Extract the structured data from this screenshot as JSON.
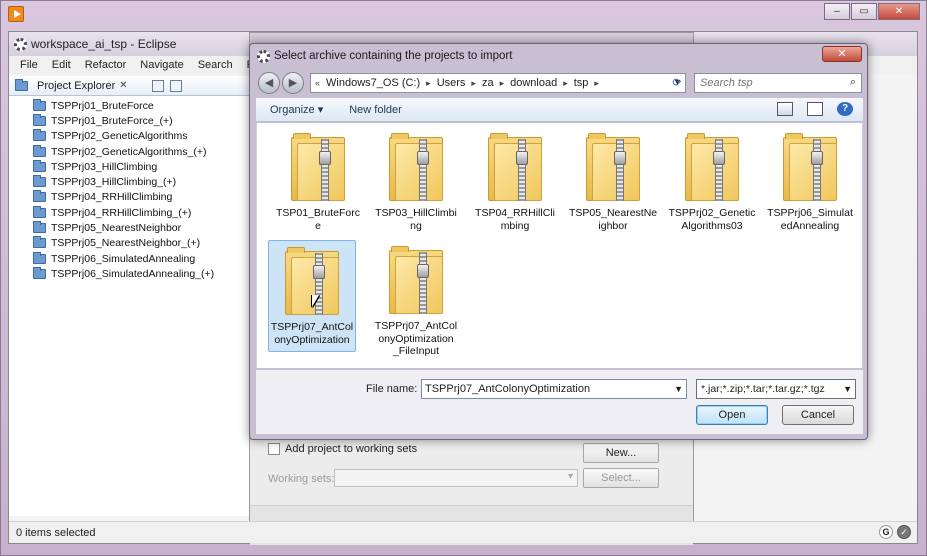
{
  "eclipse": {
    "title": "workspace_ai_tsp - Eclipse",
    "menu": [
      "File",
      "Edit",
      "Refactor",
      "Navigate",
      "Search",
      "Proje"
    ],
    "project_explorer": {
      "label": "Project Explorer",
      "close_glyph": "✕",
      "projects": [
        "TSPPrj01_BruteForce",
        "TSPPrj01_BruteForce_(+)",
        "TSPPrj02_GeneticAlgorithms",
        "TSPPrj02_GeneticAlgorithms_(+)",
        "TSPPrj03_HillClimbing",
        "TSPPrj03_HillClimbing_(+)",
        "TSPPrj04_RRHillClimbing",
        "TSPPrj04_RRHillClimbing_(+)",
        "TSPPrj05_NearestNeighbor",
        "TSPPrj05_NearestNeighbor_(+)",
        "TSPPrj06_SimulatedAnnealing",
        "TSPPrj06_SimulatedAnnealing_(+)"
      ]
    },
    "status": "0 items selected"
  },
  "wizard": {
    "add_to_working_sets": "Add project to working sets",
    "new_button": "New...",
    "working_sets_label": "Working sets:",
    "select_button": "Select..."
  },
  "dialog": {
    "title": "Select archive containing the projects to import",
    "close_glyph": "✕",
    "breadcrumb": [
      "Windows7_OS (C:)",
      "Users",
      "za",
      "download",
      "tsp"
    ],
    "breadcrumb_prefix": "«",
    "search_placeholder": "Search tsp",
    "organize": "Organize ▾",
    "new_folder": "New folder",
    "help_glyph": "?",
    "files": [
      {
        "name": "TSP01_BruteForc e"
      },
      {
        "name": "TSP03_HillClimbi ng"
      },
      {
        "name": "TSP04_RRHillCli mbing"
      },
      {
        "name": "TSP05_NearestNe ighbor"
      },
      {
        "name": "TSPPrj02_Genetic Algorithms03"
      },
      {
        "name": "TSPPrj06_Simulat edAnnealing"
      },
      {
        "name": "TSPPrj07_AntCol onyOptimization"
      },
      {
        "name": "TSPPrj07_AntCol onyOptimization _FileInput"
      }
    ],
    "file_name_label": "File name:",
    "file_name_value": "TSPPrj07_AntColonyOptimization",
    "file_type_filter": "*.jar;*.zip;*.tar;*.tar.gz;*.tgz",
    "open_button": "Open",
    "cancel_button": "Cancel"
  },
  "colors": {
    "selection": "#cde4f7",
    "title_close": "#c44a37",
    "accent": "#3c7fb1"
  }
}
